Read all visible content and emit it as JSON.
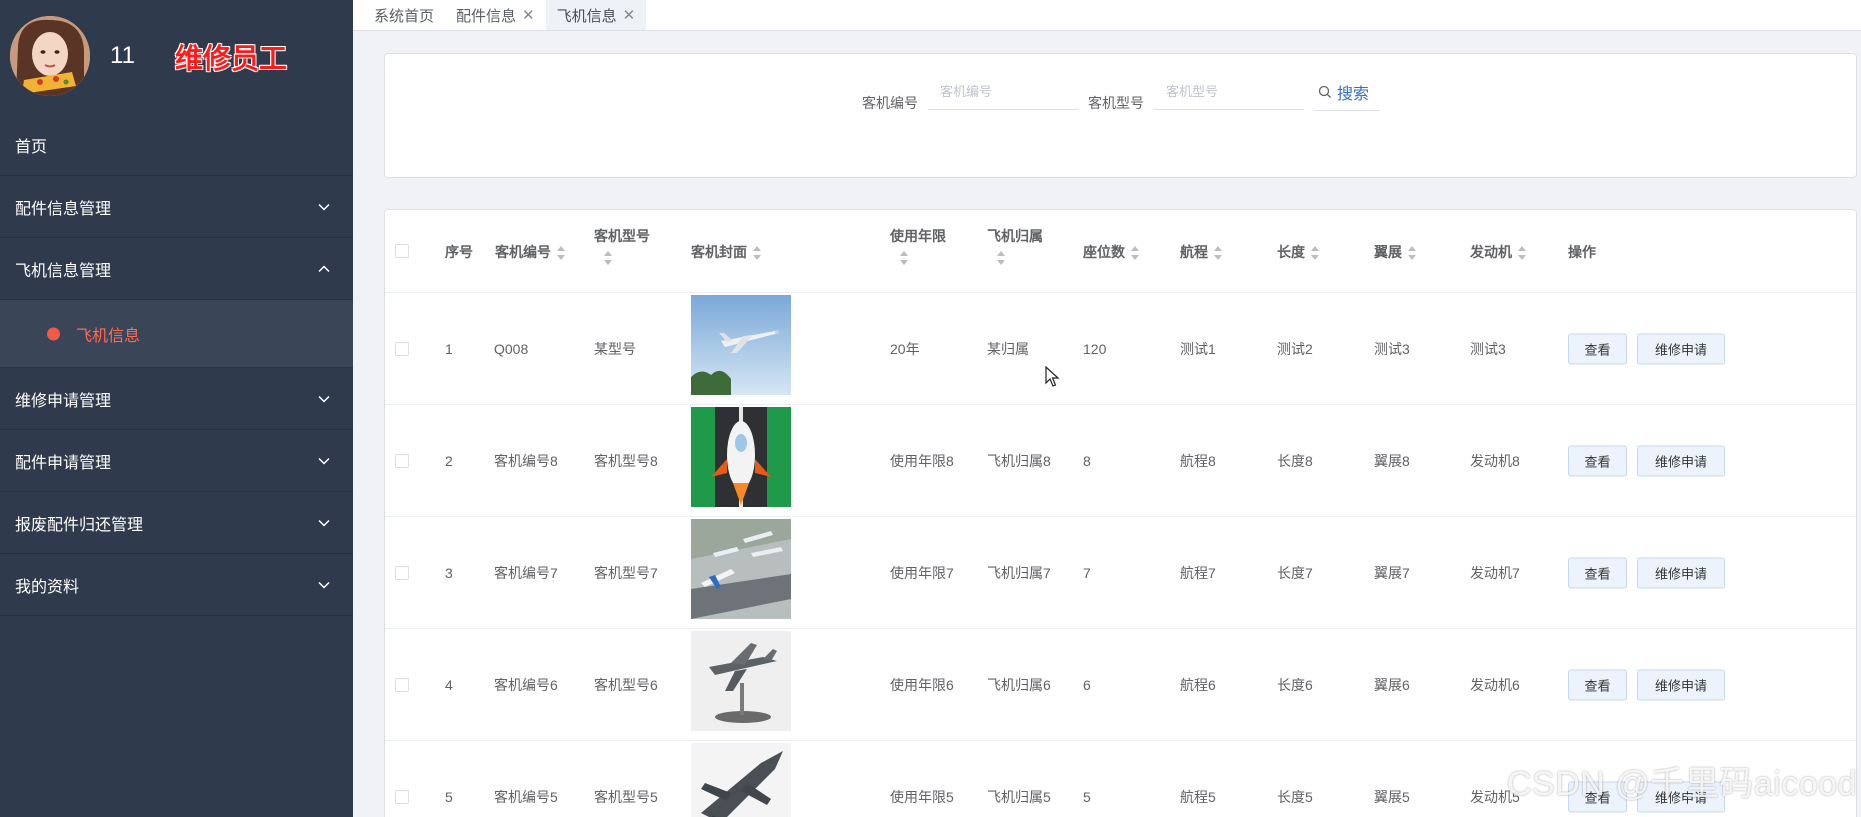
{
  "sidebar": {
    "user": {
      "name": "11",
      "role": "维修员工"
    },
    "items": [
      {
        "label": "首页"
      },
      {
        "label": "配件信息管理"
      },
      {
        "label": "飞机信息管理"
      },
      {
        "label": "维修申请管理"
      },
      {
        "label": "配件申请管理"
      },
      {
        "label": "报废配件归还管理"
      },
      {
        "label": "我的资料"
      }
    ],
    "active_sub": "飞机信息"
  },
  "tabs": [
    {
      "label": "系统首页",
      "closable": false
    },
    {
      "label": "配件信息",
      "closable": true
    },
    {
      "label": "飞机信息",
      "closable": true,
      "active": true
    }
  ],
  "search": {
    "field1": {
      "label": "客机编号",
      "placeholder": "客机编号"
    },
    "field2": {
      "label": "客机型号",
      "placeholder": "客机型号"
    },
    "button": "搜索"
  },
  "table": {
    "headers": [
      "序号",
      "客机编号",
      "客机型号",
      "客机封面",
      "使用年限",
      "飞机归属",
      "座位数",
      "航程",
      "长度",
      "翼展",
      "发动机",
      "操作"
    ],
    "rows": [
      {
        "idx": "1",
        "code": "Q008",
        "model": "某型号",
        "years": "20年",
        "owner": "某归属",
        "seats": "120",
        "range": "测试1",
        "length": "测试2",
        "span": "测试3",
        "engine": "测试3",
        "image": "airliner-takeoff"
      },
      {
        "idx": "2",
        "code": "客机编号8",
        "model": "客机型号8",
        "years": "使用年限8",
        "owner": "飞机归属8",
        "seats": "8",
        "range": "航程8",
        "length": "长度8",
        "span": "翼展8",
        "engine": "发动机8",
        "image": "rocket-runway"
      },
      {
        "idx": "3",
        "code": "客机编号7",
        "model": "客机型号7",
        "years": "使用年限7",
        "owner": "飞机归属7",
        "seats": "7",
        "range": "航程7",
        "length": "长度7",
        "span": "翼展7",
        "engine": "发动机7",
        "image": "airport-apron"
      },
      {
        "idx": "4",
        "code": "客机编号6",
        "model": "客机型号6",
        "years": "使用年限6",
        "owner": "飞机归属6",
        "seats": "6",
        "range": "航程6",
        "length": "长度6",
        "span": "翼展6",
        "engine": "发动机6",
        "image": "fighter-model"
      },
      {
        "idx": "5",
        "code": "客机编号5",
        "model": "客机型号5",
        "years": "使用年限5",
        "owner": "飞机归属5",
        "seats": "5",
        "range": "航程5",
        "length": "长度5",
        "span": "翼展5",
        "engine": "发动机5",
        "image": "fighter-jet"
      }
    ],
    "actions": {
      "view": "查看",
      "repair": "维修申请"
    }
  },
  "watermark": "CSDN @千里码aicood"
}
